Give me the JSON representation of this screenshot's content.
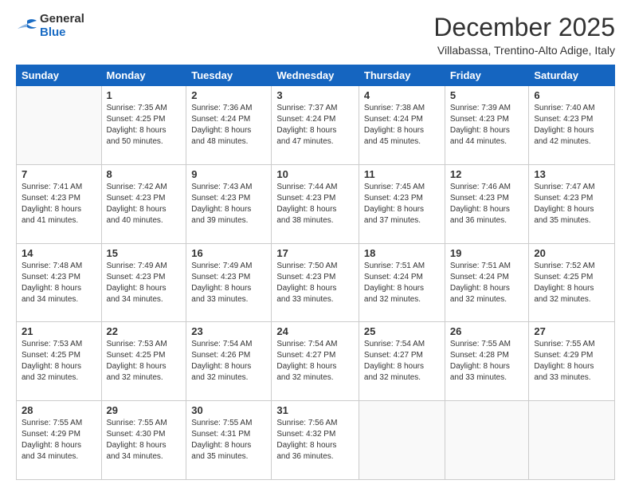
{
  "header": {
    "logo": {
      "general": "General",
      "blue": "Blue"
    },
    "title": "December 2025",
    "location": "Villabassa, Trentino-Alto Adige, Italy"
  },
  "calendar": {
    "headers": [
      "Sunday",
      "Monday",
      "Tuesday",
      "Wednesday",
      "Thursday",
      "Friday",
      "Saturday"
    ],
    "weeks": [
      [
        {
          "day": "",
          "info": ""
        },
        {
          "day": "1",
          "info": "Sunrise: 7:35 AM\nSunset: 4:25 PM\nDaylight: 8 hours\nand 50 minutes."
        },
        {
          "day": "2",
          "info": "Sunrise: 7:36 AM\nSunset: 4:24 PM\nDaylight: 8 hours\nand 48 minutes."
        },
        {
          "day": "3",
          "info": "Sunrise: 7:37 AM\nSunset: 4:24 PM\nDaylight: 8 hours\nand 47 minutes."
        },
        {
          "day": "4",
          "info": "Sunrise: 7:38 AM\nSunset: 4:24 PM\nDaylight: 8 hours\nand 45 minutes."
        },
        {
          "day": "5",
          "info": "Sunrise: 7:39 AM\nSunset: 4:23 PM\nDaylight: 8 hours\nand 44 minutes."
        },
        {
          "day": "6",
          "info": "Sunrise: 7:40 AM\nSunset: 4:23 PM\nDaylight: 8 hours\nand 42 minutes."
        }
      ],
      [
        {
          "day": "7",
          "info": "Sunrise: 7:41 AM\nSunset: 4:23 PM\nDaylight: 8 hours\nand 41 minutes."
        },
        {
          "day": "8",
          "info": "Sunrise: 7:42 AM\nSunset: 4:23 PM\nDaylight: 8 hours\nand 40 minutes."
        },
        {
          "day": "9",
          "info": "Sunrise: 7:43 AM\nSunset: 4:23 PM\nDaylight: 8 hours\nand 39 minutes."
        },
        {
          "day": "10",
          "info": "Sunrise: 7:44 AM\nSunset: 4:23 PM\nDaylight: 8 hours\nand 38 minutes."
        },
        {
          "day": "11",
          "info": "Sunrise: 7:45 AM\nSunset: 4:23 PM\nDaylight: 8 hours\nand 37 minutes."
        },
        {
          "day": "12",
          "info": "Sunrise: 7:46 AM\nSunset: 4:23 PM\nDaylight: 8 hours\nand 36 minutes."
        },
        {
          "day": "13",
          "info": "Sunrise: 7:47 AM\nSunset: 4:23 PM\nDaylight: 8 hours\nand 35 minutes."
        }
      ],
      [
        {
          "day": "14",
          "info": "Sunrise: 7:48 AM\nSunset: 4:23 PM\nDaylight: 8 hours\nand 34 minutes."
        },
        {
          "day": "15",
          "info": "Sunrise: 7:49 AM\nSunset: 4:23 PM\nDaylight: 8 hours\nand 34 minutes."
        },
        {
          "day": "16",
          "info": "Sunrise: 7:49 AM\nSunset: 4:23 PM\nDaylight: 8 hours\nand 33 minutes."
        },
        {
          "day": "17",
          "info": "Sunrise: 7:50 AM\nSunset: 4:23 PM\nDaylight: 8 hours\nand 33 minutes."
        },
        {
          "day": "18",
          "info": "Sunrise: 7:51 AM\nSunset: 4:24 PM\nDaylight: 8 hours\nand 32 minutes."
        },
        {
          "day": "19",
          "info": "Sunrise: 7:51 AM\nSunset: 4:24 PM\nDaylight: 8 hours\nand 32 minutes."
        },
        {
          "day": "20",
          "info": "Sunrise: 7:52 AM\nSunset: 4:25 PM\nDaylight: 8 hours\nand 32 minutes."
        }
      ],
      [
        {
          "day": "21",
          "info": "Sunrise: 7:53 AM\nSunset: 4:25 PM\nDaylight: 8 hours\nand 32 minutes."
        },
        {
          "day": "22",
          "info": "Sunrise: 7:53 AM\nSunset: 4:25 PM\nDaylight: 8 hours\nand 32 minutes."
        },
        {
          "day": "23",
          "info": "Sunrise: 7:54 AM\nSunset: 4:26 PM\nDaylight: 8 hours\nand 32 minutes."
        },
        {
          "day": "24",
          "info": "Sunrise: 7:54 AM\nSunset: 4:27 PM\nDaylight: 8 hours\nand 32 minutes."
        },
        {
          "day": "25",
          "info": "Sunrise: 7:54 AM\nSunset: 4:27 PM\nDaylight: 8 hours\nand 32 minutes."
        },
        {
          "day": "26",
          "info": "Sunrise: 7:55 AM\nSunset: 4:28 PM\nDaylight: 8 hours\nand 33 minutes."
        },
        {
          "day": "27",
          "info": "Sunrise: 7:55 AM\nSunset: 4:29 PM\nDaylight: 8 hours\nand 33 minutes."
        }
      ],
      [
        {
          "day": "28",
          "info": "Sunrise: 7:55 AM\nSunset: 4:29 PM\nDaylight: 8 hours\nand 34 minutes."
        },
        {
          "day": "29",
          "info": "Sunrise: 7:55 AM\nSunset: 4:30 PM\nDaylight: 8 hours\nand 34 minutes."
        },
        {
          "day": "30",
          "info": "Sunrise: 7:55 AM\nSunset: 4:31 PM\nDaylight: 8 hours\nand 35 minutes."
        },
        {
          "day": "31",
          "info": "Sunrise: 7:56 AM\nSunset: 4:32 PM\nDaylight: 8 hours\nand 36 minutes."
        },
        {
          "day": "",
          "info": ""
        },
        {
          "day": "",
          "info": ""
        },
        {
          "day": "",
          "info": ""
        }
      ]
    ]
  }
}
